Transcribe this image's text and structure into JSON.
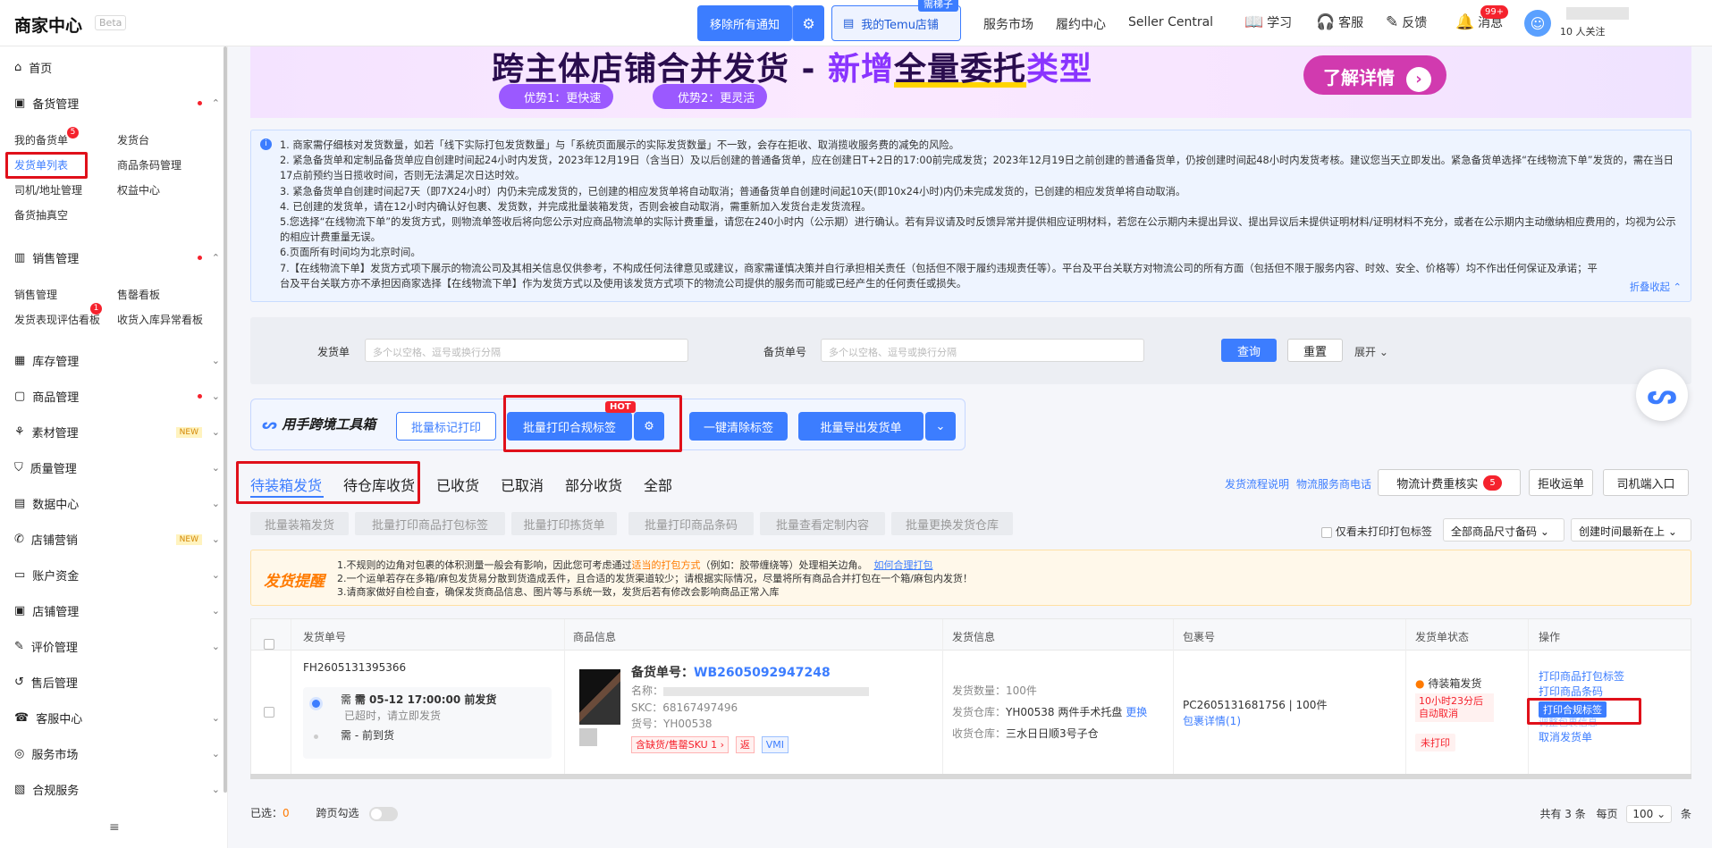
{
  "topbar": {
    "brand": "商家中心",
    "beta": "Beta",
    "remove_notice": "移除所有通知",
    "my_shop": "我的Temu店铺",
    "my_shop_tag": "需梯子",
    "nav": [
      "服务市场",
      "履约中心",
      "Seller Central"
    ],
    "icons": [
      {
        "label": "学习",
        "icon": "book-icon"
      },
      {
        "label": "客服",
        "icon": "headset-icon"
      },
      {
        "label": "反馈",
        "icon": "feedback-icon"
      },
      {
        "label": "消息",
        "icon": "bell-icon",
        "badge": "99+"
      }
    ],
    "user_sub": "10 人关注"
  },
  "sidebar": {
    "home": "首页",
    "groups": [
      {
        "label": "备货管理",
        "dot": true,
        "expanded": true
      },
      {
        "label": "销售管理",
        "dot": true,
        "expanded": true
      },
      {
        "label": "库存管理"
      },
      {
        "label": "商品管理",
        "dot": true
      },
      {
        "label": "素材管理",
        "new": "NEW"
      },
      {
        "label": "质量管理"
      },
      {
        "label": "数据中心"
      },
      {
        "label": "店铺营销",
        "new": "NEW"
      },
      {
        "label": "账户资金"
      },
      {
        "label": "店铺管理"
      },
      {
        "label": "评价管理"
      },
      {
        "label": "售后管理"
      },
      {
        "label": "客服中心"
      },
      {
        "label": "服务市场"
      },
      {
        "label": "合规服务"
      }
    ],
    "stock_sub": [
      "我的备货单",
      "发货台",
      "发货单列表",
      "商品条码管理",
      "司机/地址管理",
      "权益中心",
      "备货抽真空"
    ],
    "stock_badge": "5",
    "sales_sub": [
      "销售管理",
      "售罄看板",
      "发货表现评估看板",
      "收货入库异常看板"
    ],
    "sales_badge": "1"
  },
  "banner": {
    "title_a": "跨主体店铺合并发货 - ",
    "title_b": "新增",
    "title_c": "全量委托",
    "title_d": "类型",
    "pill1": "优势1：更快速",
    "pill2": "优势2：更灵活",
    "button": "了解详情"
  },
  "notice": {
    "lines": [
      "1. 商家需仔细核对发货数量，如若「线下实际打包发货数量」与「系统页面展示的实际发货数量」不一致，会存在拒收、取消揽收服务费的减免的风险。",
      "2. 紧急备货单和定制品备货单应自创建时间起24小时内发货，2023年12月19日（含当日）及以后创建的普通备货单，应在创建日T+2日的17:00前完成发货；2023年12月19日之前创建的普通备货单，仍按创建时间起48小时内发货考核。建议您当天立即发出。紧急备货单选择“在线物流下单”发货的，需在当日17点前预约当日揽收时间，否则无法满足次日达时效。",
      "3. 紧急备货单自创建时间起7天（即7X24小时）内仍未完成发货的，已创建的相应发货单将自动取消；普通备货单自创建时间起10天(即10x24小时)内仍未完成发货的，已创建的相应发货单将自动取消。",
      "4. 已创建的发货单，请在12小时内确认好包裹、发货数，并完成批量装箱发货，否则会被自动取消，需重新加入发货台走发货流程。",
      "5.您选择“在线物流下单”的发货方式，则物流单签收后将向您公示对应商品物流单的实际计费重量，请您在240小时内（公示期）进行确认。若有异议请及时反馈异常并提供相应证明材料，若您在公示期内未提出异议、提出异议后未提供证明材料/证明材料不充分，或者在公示期内主动缴纳相应费用的，均视为公示的相应计费重量无误。",
      "6.页面所有时间均为北京时间。",
      "7.【在线物流下单】发货方式项下展示的物流公司及其相关信息仅供参考，不构成任何法律意见或建议，商家需谨慎决策并自行承担相关责任（包括但不限于履约违规责任等）。平台及平台关联方对物流公司的所有方面（包括但不限于服务内容、时效、安全、价格等）均不作出任何保证及承诺；平台及平台关联方亦不承担因商家选择【在线物流下单】作为发货方式以及使用该发货方式项下的物流公司提供的服务而可能或已经产生的任何责任或损失。"
    ],
    "collapse": "折叠收起 ⌃"
  },
  "search": {
    "label1": "发货单",
    "placeholder1": "多个以空格、逗号或换行分隔",
    "label2": "备货单号",
    "placeholder2": "多个以空格、逗号或换行分隔",
    "query": "查询",
    "reset": "重置",
    "expand": "展开 ⌄"
  },
  "toolbox": {
    "logo": "用手跨境工具箱",
    "btn1": "批量标记打印",
    "btn2": "批量打印合规标签",
    "hot": "HOT",
    "btn3": "一键清除标签",
    "btn4": "批量导出发货单"
  },
  "tabs": [
    "待装箱发货",
    "待仓库收货",
    "已收货",
    "已取消",
    "部分收货",
    "全部"
  ],
  "right_actions": {
    "link1": "发货流程说明",
    "link2": "物流服务商电话",
    "btn1": "物流计费重核实",
    "btn1_badge": "5",
    "btn2": "拒收运单",
    "btn3": "司机端入口"
  },
  "batch_buttons": [
    "批量装箱发货",
    "批量打印商品打包标签",
    "批量打印拣货单",
    "批量打印商品条码",
    "批量查看定制内容",
    "批量更换发货仓库"
  ],
  "filters": {
    "only_unprinted": "仅看未打印打包标签",
    "size": "全部商品尺寸备码 ⌄",
    "sort": "创建时间最新在上 ⌄"
  },
  "remind": {
    "title": "发货提醒",
    "line1_a": "1.不规则的边角对包裹的体积测量一般会有影响，因此您可考虑通过",
    "line1_b": "适当的打包方式",
    "line1_c": "（例如：胶带缠绕等）处理相关边角。",
    "line1_link": "如何合理打包",
    "line2": "2.一个运单若存在多箱/麻包发货易分散到货造成丢件，且合适的发货渠道较少；请根据实际情况，尽量将所有商品合并打包在一个箱/麻包内发货！",
    "line3": "3.请商家做好自检自查，确保发货商品信息、图片等与系统一致，发货后若有修改会影响商品正常入库"
  },
  "table": {
    "headers": [
      "发货单号",
      "商品信息",
      "发货信息",
      "包裹号",
      "发货单状态",
      "操作"
    ],
    "row": {
      "ship_no": "FH2605131395366",
      "need_time": "需 05-12 17:00:00 前发货",
      "overdue": "已超时，请立即发货",
      "need_arrive": "需 - 前到货",
      "stock_label": "备货单号：",
      "stock_no": "WB2605092947248",
      "name_label": "名称：",
      "skc": "SKC：68167497496",
      "sku_no": "货号：YH00538",
      "tag1": "含缺货/售罄SKU 1 ›",
      "tag2": "返",
      "tag3": "VMI",
      "qty": "发货数量：100件",
      "ship_wh_label": "发货仓库：",
      "ship_wh": "YH00538 两件手术托盘",
      "change": "更换",
      "recv_wh_label": "收货仓库：",
      "recv_wh": "三水日日顺3号子仓",
      "pkg_no": "PC2605131681756 | 100件",
      "pkg_detail": "包裹详情(1)",
      "status": "待装箱发货",
      "countdown": "10小时23分后自动取消",
      "unprinted": "未打印",
      "ops": [
        "打印商品打包标签",
        "打印商品条码",
        "打印合规标签",
        "调整包裹信息",
        "取消发货单"
      ]
    }
  },
  "footer": {
    "selected_label": "已选：",
    "selected_count": "0",
    "cross_page": "跨页勾选",
    "total": "共有 3 条",
    "per_page": "每页",
    "page_size": "100 ⌄",
    "unit": "条"
  }
}
